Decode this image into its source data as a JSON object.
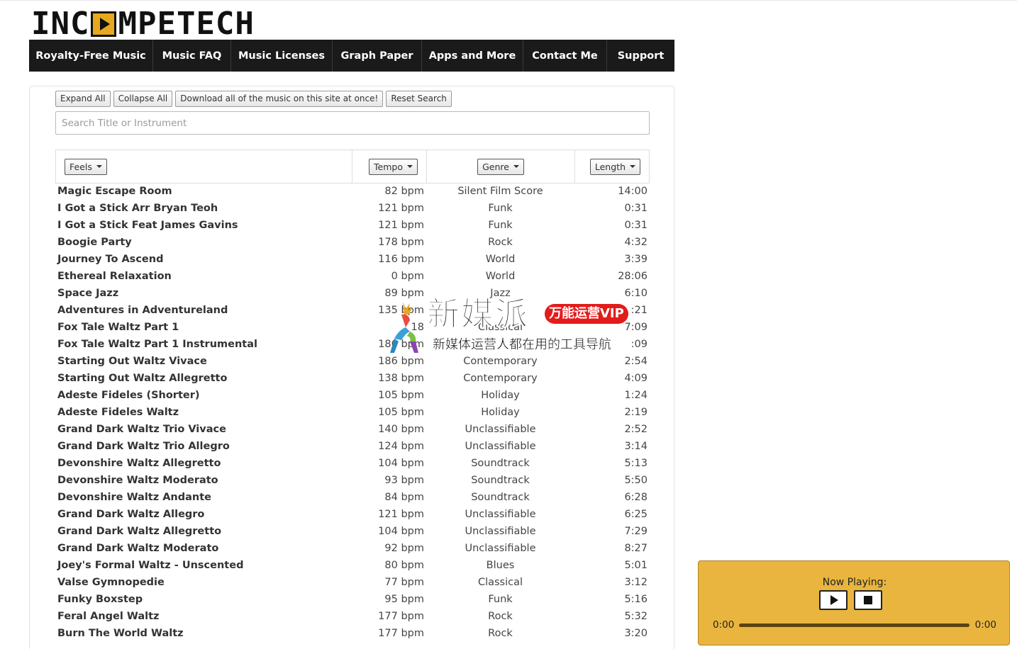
{
  "logo": {
    "part1": "INC",
    "part2": "MPETECH"
  },
  "nav": [
    {
      "label": "Royalty-Free Music"
    },
    {
      "label": "Music FAQ"
    },
    {
      "label": "Music Licenses"
    },
    {
      "label": "Graph Paper"
    },
    {
      "label": "Apps and More"
    },
    {
      "label": "Contact Me"
    },
    {
      "label": "Support"
    }
  ],
  "toolbar": {
    "expand_all": "Expand All",
    "collapse_all": "Collapse All",
    "download_all": "Download all of the music on this site at once!",
    "reset_search": "Reset Search"
  },
  "search": {
    "placeholder": "Search Title or Instrument",
    "value": ""
  },
  "columns": {
    "feels": "Feels",
    "tempo": "Tempo",
    "genre": "Genre",
    "length": "Length"
  },
  "tracks": [
    {
      "title": "Magic Escape Room",
      "tempo": "82 bpm",
      "genre": "Silent Film Score",
      "length": "14:00"
    },
    {
      "title": "I Got a Stick Arr Bryan Teoh",
      "tempo": "121 bpm",
      "genre": "Funk",
      "length": "0:31"
    },
    {
      "title": "I Got a Stick Feat James Gavins",
      "tempo": "121 bpm",
      "genre": "Funk",
      "length": "0:31"
    },
    {
      "title": "Boogie Party",
      "tempo": "178 bpm",
      "genre": "Rock",
      "length": "4:32"
    },
    {
      "title": "Journey To Ascend",
      "tempo": "116 bpm",
      "genre": "World",
      "length": "3:39"
    },
    {
      "title": "Ethereal Relaxation",
      "tempo": "0 bpm",
      "genre": "World",
      "length": "28:06"
    },
    {
      "title": "Space Jazz",
      "tempo": "89 bpm",
      "genre": "Jazz",
      "length": "6:10"
    },
    {
      "title": "Adventures in Adventureland",
      "tempo": "135 bpm",
      "genre": "",
      "length": ":21"
    },
    {
      "title": "Fox Tale Waltz Part 1",
      "tempo": "18",
      "genre": "Classical",
      "length": "7:09"
    },
    {
      "title": "Fox Tale Waltz Part 1 Instrumental",
      "tempo": "186 bpm",
      "genre": "",
      "length": ":09"
    },
    {
      "title": "Starting Out Waltz Vivace",
      "tempo": "186 bpm",
      "genre": "Contemporary",
      "length": "2:54"
    },
    {
      "title": "Starting Out Waltz Allegretto",
      "tempo": "138 bpm",
      "genre": "Contemporary",
      "length": "4:09"
    },
    {
      "title": "Adeste Fideles (Shorter)",
      "tempo": "105 bpm",
      "genre": "Holiday",
      "length": "1:24"
    },
    {
      "title": "Adeste Fideles Waltz",
      "tempo": "105 bpm",
      "genre": "Holiday",
      "length": "2:19"
    },
    {
      "title": "Grand Dark Waltz Trio Vivace",
      "tempo": "140 bpm",
      "genre": "Unclassifiable",
      "length": "2:52"
    },
    {
      "title": "Grand Dark Waltz Trio Allegro",
      "tempo": "124 bpm",
      "genre": "Unclassifiable",
      "length": "3:14"
    },
    {
      "title": "Devonshire Waltz Allegretto",
      "tempo": "104 bpm",
      "genre": "Soundtrack",
      "length": "5:13"
    },
    {
      "title": "Devonshire Waltz Moderato",
      "tempo": "93 bpm",
      "genre": "Soundtrack",
      "length": "5:50"
    },
    {
      "title": "Devonshire Waltz Andante",
      "tempo": "84 bpm",
      "genre": "Soundtrack",
      "length": "6:28"
    },
    {
      "title": "Grand Dark Waltz Allegro",
      "tempo": "121 bpm",
      "genre": "Unclassifiable",
      "length": "6:25"
    },
    {
      "title": "Grand Dark Waltz Allegretto",
      "tempo": "104 bpm",
      "genre": "Unclassifiable",
      "length": "7:29"
    },
    {
      "title": "Grand Dark Waltz Moderato",
      "tempo": "92 bpm",
      "genre": "Unclassifiable",
      "length": "8:27"
    },
    {
      "title": "Joey's Formal Waltz - Unscented",
      "tempo": "80 bpm",
      "genre": "Blues",
      "length": "5:01"
    },
    {
      "title": "Valse Gymnopedie",
      "tempo": "77 bpm",
      "genre": "Classical",
      "length": "3:12"
    },
    {
      "title": "Funky Boxstep",
      "tempo": "95 bpm",
      "genre": "Funk",
      "length": "5:16"
    },
    {
      "title": "Feral Angel Waltz",
      "tempo": "177 bpm",
      "genre": "Rock",
      "length": "5:32"
    },
    {
      "title": "Burn The World Waltz",
      "tempo": "177 bpm",
      "genre": "Rock",
      "length": "3:20"
    }
  ],
  "watermark": {
    "title": "新媒派",
    "badge": "万能运营VIP",
    "subtitle": "新媒体运营人都在用的工具导航"
  },
  "player": {
    "now_playing": "Now Playing:",
    "current_time": "0:00",
    "total_time": "0:00"
  },
  "colors": {
    "accent": "#e9b53e",
    "nav_bg": "#1a1a1a",
    "vip_red": "#e31b1b"
  }
}
